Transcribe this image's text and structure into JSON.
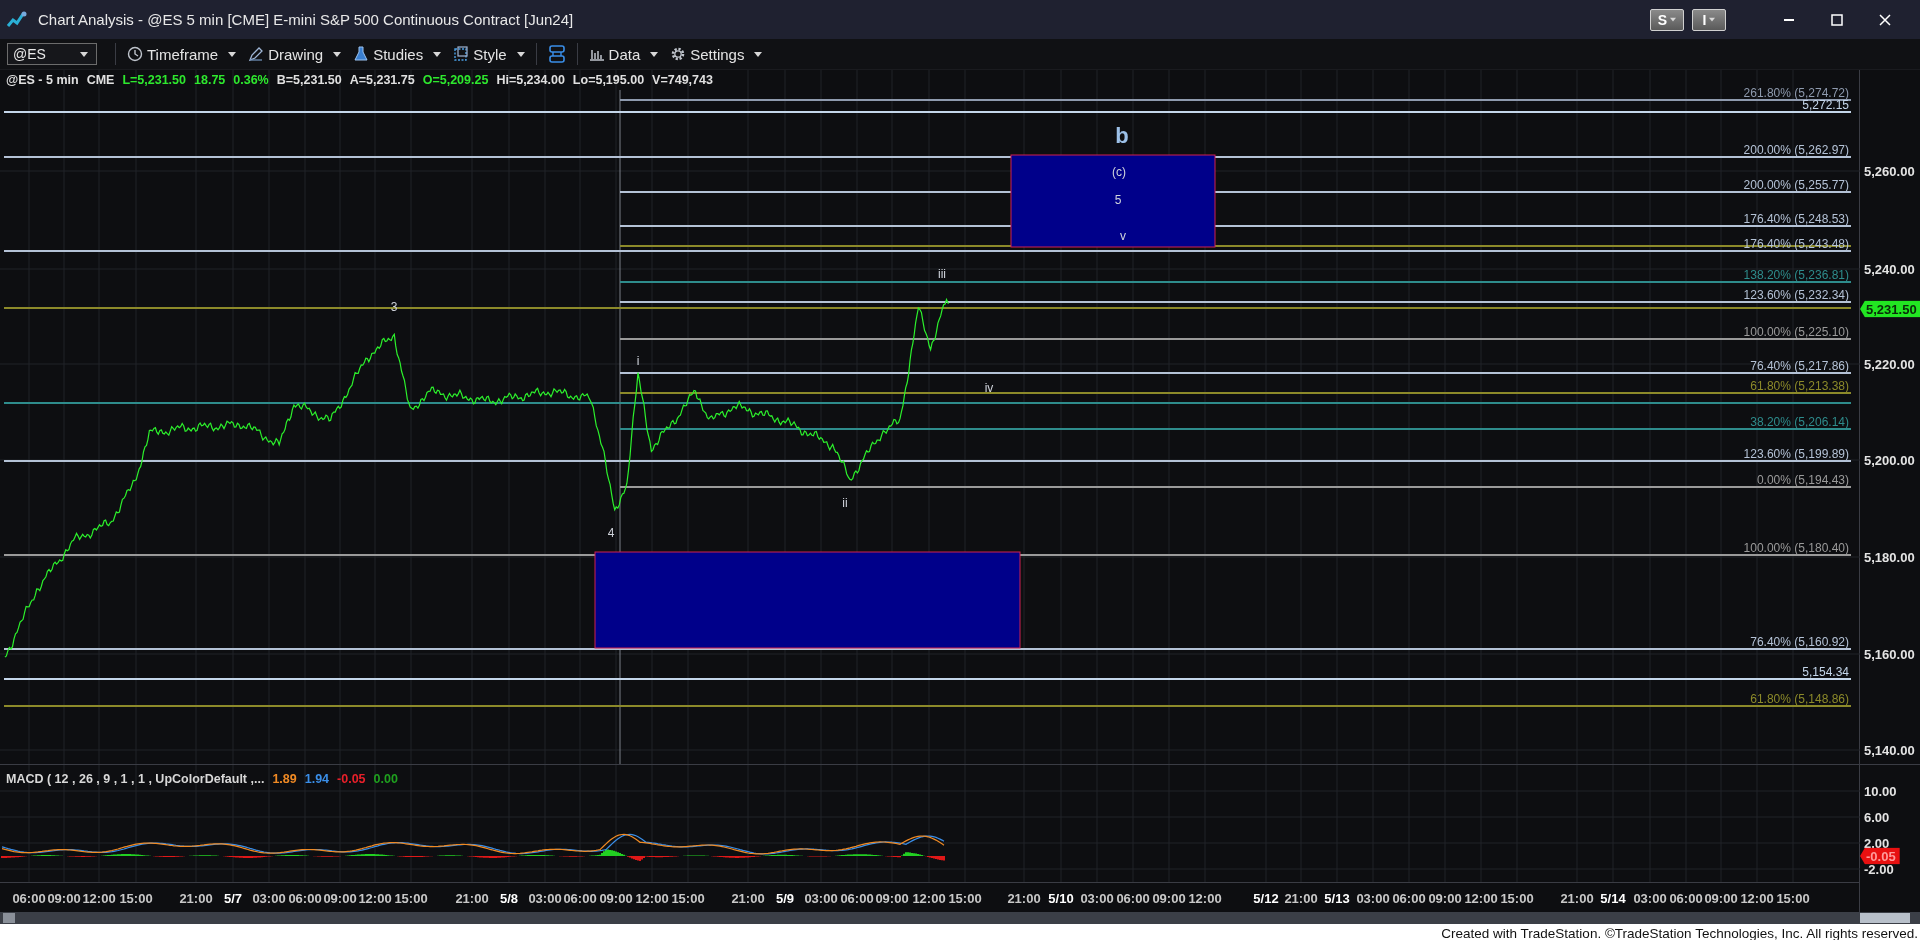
{
  "window": {
    "title": "Chart Analysis - @ES 5 min [CME] E-mini S&P 500 Continuous Contract [Jun24]",
    "buttons": [
      {
        "label": "S"
      },
      {
        "label": "I"
      }
    ]
  },
  "toolbar": {
    "symbol": "@ES",
    "items": [
      {
        "kind": "clock",
        "label": "Timeframe"
      },
      {
        "kind": "pencil",
        "label": "Drawing"
      },
      {
        "kind": "flask",
        "label": "Studies"
      },
      {
        "kind": "style",
        "label": "Style"
      },
      {
        "kind": "link"
      },
      {
        "kind": "bars",
        "label": "Data"
      },
      {
        "kind": "gear",
        "label": "Settings"
      }
    ]
  },
  "quote_line": [
    {
      "text": "@ES - 5 min",
      "color": "#e0e0e0"
    },
    {
      "text": "CME",
      "color": "#e0e0e0"
    },
    {
      "text": "L=5,231.50",
      "color": "#2ee82e"
    },
    {
      "text": "18.75",
      "color": "#2ee82e"
    },
    {
      "text": "0.36%",
      "color": "#2ee82e"
    },
    {
      "text": "B=5,231.50",
      "color": "#e0e0e0"
    },
    {
      "text": "A=5,231.75",
      "color": "#e0e0e0"
    },
    {
      "text": "O=5,209.25",
      "color": "#2ee82e"
    },
    {
      "text": "Hi=5,234.00",
      "color": "#e0e0e0"
    },
    {
      "text": "Lo=5,195.00",
      "color": "#e0e0e0"
    },
    {
      "text": "V=749,743",
      "color": "#e0e0e0"
    }
  ],
  "fib_levels": [
    {
      "label": "261.80% (5,274.72)",
      "color": "#8e9aae",
      "extends_left": false
    },
    {
      "label": "5,272.15",
      "color": "#c4d6ea",
      "extends_left": true
    },
    {
      "label": "200.00% (5,262.97)",
      "color": "#b4c2d6",
      "extends_left": true
    },
    {
      "label": "200.00% (5,255.77)",
      "color": "#b4c2d6",
      "extends_left": false
    },
    {
      "label": "176.40% (5,248.53)",
      "color": "#b4c2d6",
      "extends_left": false
    },
    {
      "color": "#8c8a2a",
      "extends_left": false
    },
    {
      "label": "176.40% (5,243.48)",
      "color": "#b4c2d6",
      "extends_left": true
    },
    {
      "label": "138.20% (5,236.81)",
      "color": "#2e8c8c",
      "extends_left": false
    },
    {
      "label": "123.60% (5,232.34)",
      "color": "#b4c2d6",
      "extends_left": false
    },
    {
      "color": "#8c8a2a",
      "extends_left": true
    },
    {
      "label": "100.00% (5,225.10)",
      "color": "#9a9a9a",
      "extends_left": false
    },
    {
      "label": "76.40% (5,217.86)",
      "color": "#b4c2d6",
      "extends_left": false
    },
    {
      "label": "61.80% (5,213.38)",
      "color": "#8c8a2a",
      "extends_left": false
    },
    {
      "color": "#2e8c8c",
      "extends_left": true
    },
    {
      "label": "38.20% (5,206.14)",
      "color": "#2e8c8c",
      "extends_left": false
    },
    {
      "label": "123.60% (5,199.89)",
      "color": "#b4c2d6",
      "extends_left": true
    },
    {
      "label": "0.00% (5,194.43)",
      "color": "#9a9a9a",
      "extends_left": false
    },
    {
      "label": "100.00% (5,180.40)",
      "color": "#9a9a9a",
      "extends_left": true
    },
    {
      "label": "76.40% (5,160.92)",
      "color": "#b4c2d6",
      "extends_left": true
    },
    {
      "label": "5,154.34",
      "color": "#c4d6ea",
      "extends_left": true
    },
    {
      "label": "61.80% (5,148.86)",
      "color": "#8c8a2a",
      "extends_left": true
    }
  ],
  "wave_labels": [
    {
      "text": "b",
      "kind": "major"
    },
    {
      "text": "(c)",
      "kind": "minor"
    },
    {
      "text": "5",
      "kind": "minor"
    },
    {
      "text": "v",
      "kind": "minor"
    },
    {
      "text": "iii",
      "kind": "minor"
    },
    {
      "text": "3",
      "kind": "minor"
    },
    {
      "text": "i",
      "kind": "minor"
    },
    {
      "text": "iv",
      "kind": "minor"
    },
    {
      "text": "ii",
      "kind": "minor"
    },
    {
      "text": "4",
      "kind": "minor"
    }
  ],
  "price_axis": {
    "labels": [
      "5,260.00",
      "5,240.00",
      "5,220.00",
      "5,200.00",
      "5,180.00",
      "5,160.00",
      "5,140.00"
    ],
    "last_price": "5,231.50"
  },
  "macd": {
    "title": "MACD ( 12 , 26 , 9 , 1 , 1 , UpColorDefault ,...",
    "readings": [
      {
        "text": "1.89",
        "color": "#f08a24"
      },
      {
        "text": "1.94",
        "color": "#3a8ee8"
      },
      {
        "text": "-0.05",
        "color": "#e8202a"
      },
      {
        "text": "0.00",
        "color": "#1fa01f"
      }
    ],
    "axis_labels": [
      "10.00",
      "6.00",
      "2.00",
      "-2.00"
    ],
    "last_value": "-0.05"
  },
  "time_axis": [
    {
      "text": "06:00",
      "kind": "time"
    },
    {
      "text": "09:00",
      "kind": "time"
    },
    {
      "text": "12:00",
      "kind": "time"
    },
    {
      "text": "15:00",
      "kind": "time"
    },
    {
      "text": "21:00",
      "kind": "time"
    },
    {
      "text": "5/7",
      "kind": "date"
    },
    {
      "text": "03:00",
      "kind": "time"
    },
    {
      "text": "06:00",
      "kind": "time"
    },
    {
      "text": "09:00",
      "kind": "time"
    },
    {
      "text": "12:00",
      "kind": "time"
    },
    {
      "text": "15:00",
      "kind": "time"
    },
    {
      "text": "21:00",
      "kind": "time"
    },
    {
      "text": "5/8",
      "kind": "date"
    },
    {
      "text": "03:00",
      "kind": "time"
    },
    {
      "text": "06:00",
      "kind": "time"
    },
    {
      "text": "09:00",
      "kind": "time"
    },
    {
      "text": "12:00",
      "kind": "time"
    },
    {
      "text": "15:00",
      "kind": "time"
    },
    {
      "text": "21:00",
      "kind": "time"
    },
    {
      "text": "5/9",
      "kind": "date"
    },
    {
      "text": "03:00",
      "kind": "time"
    },
    {
      "text": "06:00",
      "kind": "time"
    },
    {
      "text": "09:00",
      "kind": "time"
    },
    {
      "text": "12:00",
      "kind": "time"
    },
    {
      "text": "15:00",
      "kind": "time"
    },
    {
      "text": "21:00",
      "kind": "time"
    },
    {
      "text": "5/10",
      "kind": "date"
    },
    {
      "text": "03:00",
      "kind": "time"
    },
    {
      "text": "06:00",
      "kind": "time"
    },
    {
      "text": "09:00",
      "kind": "time"
    },
    {
      "text": "12:00",
      "kind": "time"
    },
    {
      "text": "5/12",
      "kind": "date"
    },
    {
      "text": "21:00",
      "kind": "time"
    },
    {
      "text": "5/13",
      "kind": "date"
    },
    {
      "text": "03:00",
      "kind": "time"
    },
    {
      "text": "06:00",
      "kind": "time"
    },
    {
      "text": "09:00",
      "kind": "time"
    },
    {
      "text": "12:00",
      "kind": "time"
    },
    {
      "text": "15:00",
      "kind": "time"
    },
    {
      "text": "21:00",
      "kind": "time"
    },
    {
      "text": "5/14",
      "kind": "date"
    },
    {
      "text": "03:00",
      "kind": "time"
    },
    {
      "text": "06:00",
      "kind": "time"
    },
    {
      "text": "09:00",
      "kind": "time"
    },
    {
      "text": "12:00",
      "kind": "time"
    },
    {
      "text": "15:00",
      "kind": "time"
    }
  ],
  "footer": "Created with TradeStation. ©TradeStation Technologies, Inc. All rights reserved."
}
